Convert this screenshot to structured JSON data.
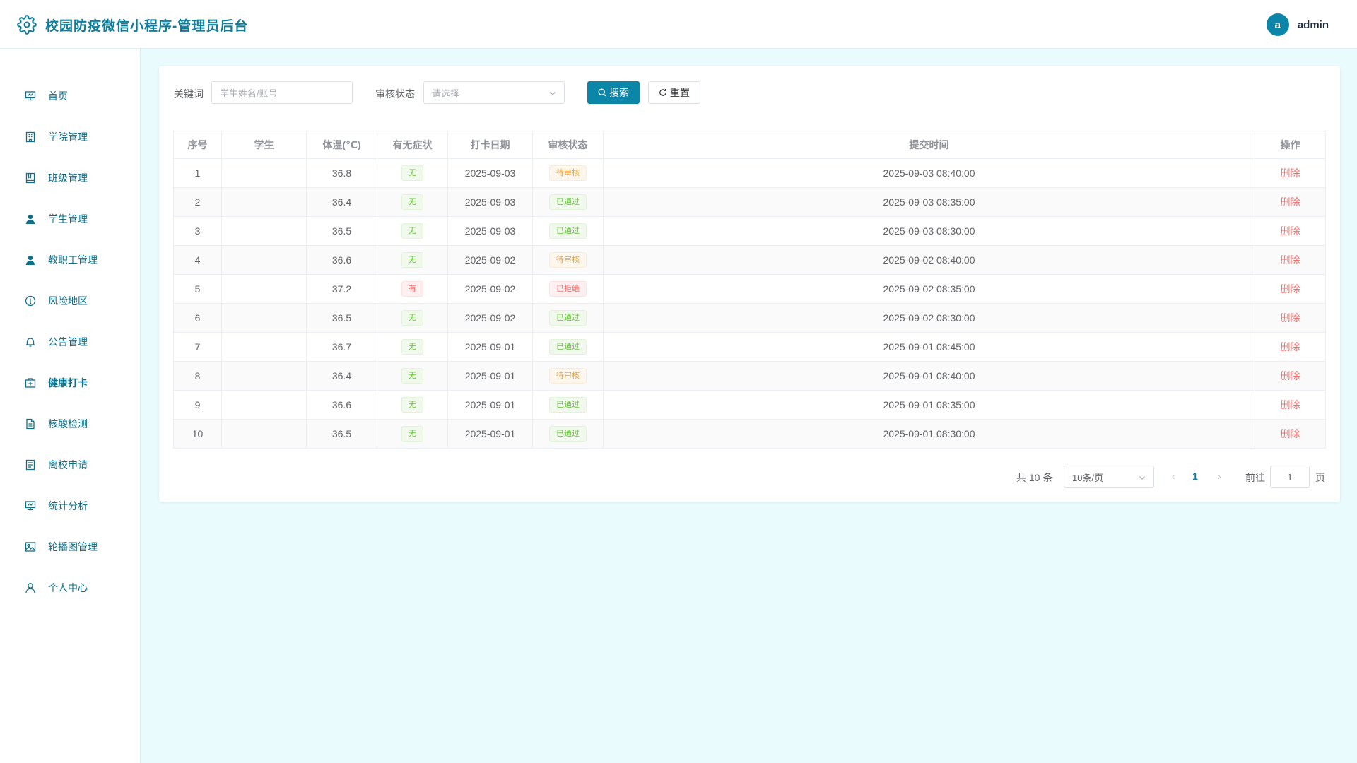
{
  "header": {
    "title": "校园防疫微信小程序-管理员后台",
    "avatar_letter": "a",
    "username": "admin",
    "icon": "gear-icon"
  },
  "colors": {
    "accent": "#0b86a8",
    "title": "#0d7e9c",
    "background": "#eafbfd",
    "success": "#67c23a",
    "warning": "#e6a23c",
    "danger": "#f56c6c"
  },
  "sidebar": {
    "items": [
      {
        "label": "首页",
        "icon": "presentation-icon"
      },
      {
        "label": "学院管理",
        "icon": "building-icon"
      },
      {
        "label": "班级管理",
        "icon": "book-icon"
      },
      {
        "label": "学生管理",
        "icon": "user-icon"
      },
      {
        "label": "教职工管理",
        "icon": "user-icon"
      },
      {
        "label": "风险地区",
        "icon": "info-circle-icon"
      },
      {
        "label": "公告管理",
        "icon": "bell-icon"
      },
      {
        "label": "健康打卡",
        "icon": "first-aid-kit-icon",
        "active": true
      },
      {
        "label": "核酸检测",
        "icon": "document-icon"
      },
      {
        "label": "离校申请",
        "icon": "list-document-icon"
      },
      {
        "label": "统计分析",
        "icon": "presentation-icon"
      },
      {
        "label": "轮播图管理",
        "icon": "image-icon"
      },
      {
        "label": "个人中心",
        "icon": "user-outline-icon"
      }
    ]
  },
  "filters": {
    "keyword_label": "关键词",
    "keyword_placeholder": "学生姓名/账号",
    "status_label": "审核状态",
    "status_placeholder": "请选择",
    "search_label": "搜索",
    "reset_label": "重置"
  },
  "table": {
    "columns": [
      "序号",
      "学生",
      "体温(℃)",
      "有无症状",
      "打卡日期",
      "审核状态",
      "提交时间",
      "操作"
    ],
    "rows": [
      {
        "index": "1",
        "student": "",
        "temperature": "36.8",
        "symptom": "无",
        "symptom_type": "success",
        "date": "2025-09-03",
        "status": "待审核",
        "status_type": "warning",
        "submitted": "2025-09-03 08:40:00",
        "action": "删除"
      },
      {
        "index": "2",
        "student": "",
        "temperature": "36.4",
        "symptom": "无",
        "symptom_type": "success",
        "date": "2025-09-03",
        "status": "已通过",
        "status_type": "success",
        "submitted": "2025-09-03 08:35:00",
        "action": "删除"
      },
      {
        "index": "3",
        "student": "",
        "temperature": "36.5",
        "symptom": "无",
        "symptom_type": "success",
        "date": "2025-09-03",
        "status": "已通过",
        "status_type": "success",
        "submitted": "2025-09-03 08:30:00",
        "action": "删除"
      },
      {
        "index": "4",
        "student": "",
        "temperature": "36.6",
        "symptom": "无",
        "symptom_type": "success",
        "date": "2025-09-02",
        "status": "待审核",
        "status_type": "warning",
        "submitted": "2025-09-02 08:40:00",
        "action": "删除"
      },
      {
        "index": "5",
        "student": "",
        "temperature": "37.2",
        "symptom": "有",
        "symptom_type": "danger",
        "date": "2025-09-02",
        "status": "已拒绝",
        "status_type": "danger",
        "submitted": "2025-09-02 08:35:00",
        "action": "删除"
      },
      {
        "index": "6",
        "student": "",
        "temperature": "36.5",
        "symptom": "无",
        "symptom_type": "success",
        "date": "2025-09-02",
        "status": "已通过",
        "status_type": "success",
        "submitted": "2025-09-02 08:30:00",
        "action": "删除"
      },
      {
        "index": "7",
        "student": "",
        "temperature": "36.7",
        "symptom": "无",
        "symptom_type": "success",
        "date": "2025-09-01",
        "status": "已通过",
        "status_type": "success",
        "submitted": "2025-09-01 08:45:00",
        "action": "删除"
      },
      {
        "index": "8",
        "student": "",
        "temperature": "36.4",
        "symptom": "无",
        "symptom_type": "success",
        "date": "2025-09-01",
        "status": "待审核",
        "status_type": "warning",
        "submitted": "2025-09-01 08:40:00",
        "action": "删除"
      },
      {
        "index": "9",
        "student": "",
        "temperature": "36.6",
        "symptom": "无",
        "symptom_type": "success",
        "date": "2025-09-01",
        "status": "已通过",
        "status_type": "success",
        "submitted": "2025-09-01 08:35:00",
        "action": "删除"
      },
      {
        "index": "10",
        "student": "",
        "temperature": "36.5",
        "symptom": "无",
        "symptom_type": "success",
        "date": "2025-09-01",
        "status": "已通过",
        "status_type": "success",
        "submitted": "2025-09-01 08:30:00",
        "action": "删除"
      }
    ]
  },
  "pagination": {
    "total_text": "共 10 条",
    "page_size": "10条/页",
    "current_page": "1",
    "goto_label": "前往",
    "goto_value": "1",
    "page_unit": "页"
  }
}
